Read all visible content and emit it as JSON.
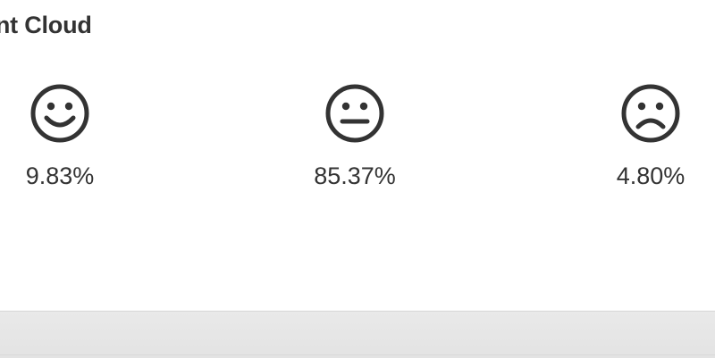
{
  "panel": {
    "title": "ent Cloud"
  },
  "sentiments": [
    {
      "icon": "smiley-face-icon",
      "value": "9.83%"
    },
    {
      "icon": "neutral-face-icon",
      "value": "85.37%"
    },
    {
      "icon": "sad-face-icon",
      "value": "4.80%"
    }
  ],
  "colors": {
    "text": "#333333",
    "footer": "#e6e6e6"
  }
}
